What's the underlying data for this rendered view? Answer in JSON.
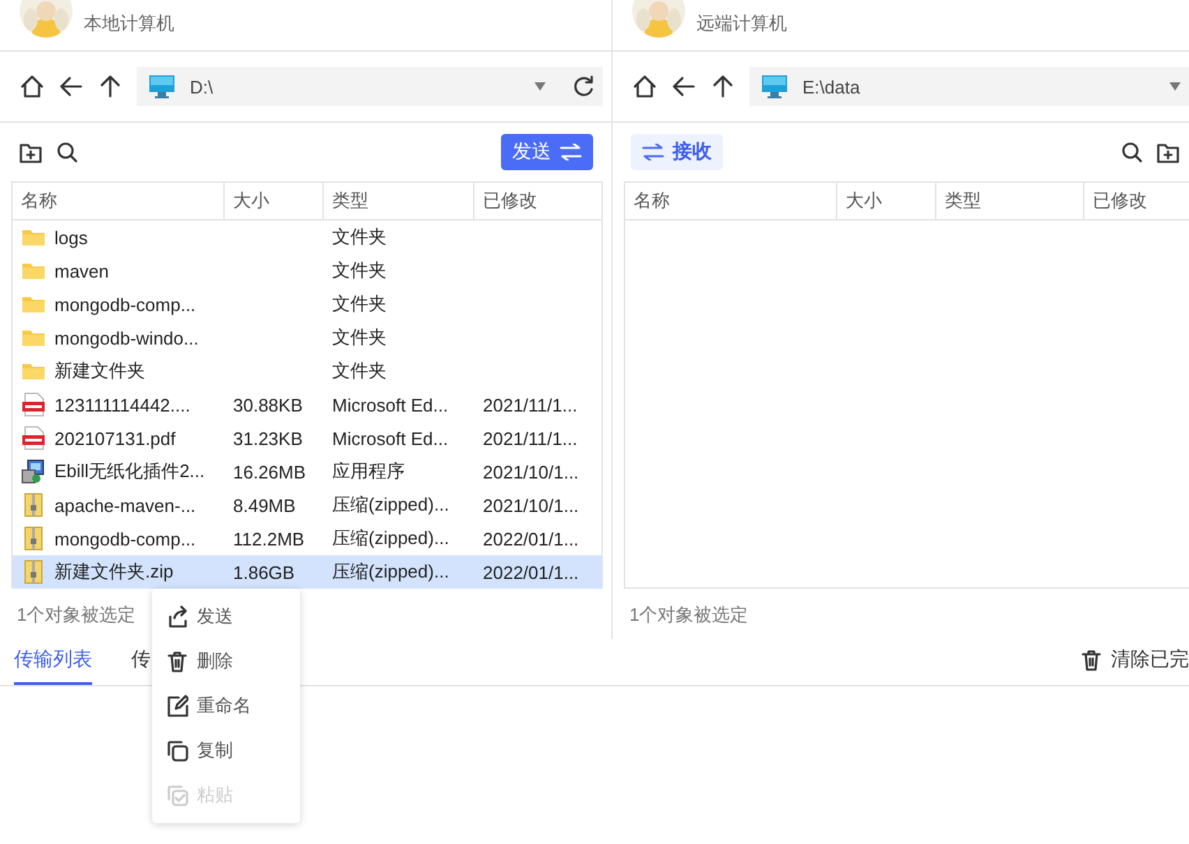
{
  "panels": [
    {
      "subtitle": "本地计算机",
      "path": "D:\\",
      "action": {
        "label": "发送",
        "kind": "send"
      },
      "columns": [
        "名称",
        "大小",
        "类型",
        "已修改"
      ],
      "rows": [
        {
          "kind": "folder",
          "name": "logs",
          "size": "",
          "type": "文件夹",
          "modified": "",
          "selected": false
        },
        {
          "kind": "folder",
          "name": "maven",
          "size": "",
          "type": "文件夹",
          "modified": "",
          "selected": false
        },
        {
          "kind": "folder",
          "name": "mongodb-comp...",
          "size": "",
          "type": "文件夹",
          "modified": "",
          "selected": false
        },
        {
          "kind": "folder",
          "name": "mongodb-windo...",
          "size": "",
          "type": "文件夹",
          "modified": "",
          "selected": false
        },
        {
          "kind": "folder",
          "name": "新建文件夹",
          "size": "",
          "type": "文件夹",
          "modified": "",
          "selected": false
        },
        {
          "kind": "pdf",
          "name": "123111114442....",
          "size": "30.88KB",
          "type": "Microsoft Ed...",
          "modified": "2021/11/1...",
          "selected": false
        },
        {
          "kind": "pdf",
          "name": "202107131.pdf",
          "size": "31.23KB",
          "type": "Microsoft Ed...",
          "modified": "2021/11/1...",
          "selected": false
        },
        {
          "kind": "app",
          "name": "Ebill无纸化插件2...",
          "size": "16.26MB",
          "type": "应用程序",
          "modified": "2021/10/1...",
          "selected": false
        },
        {
          "kind": "zip",
          "name": "apache-maven-...",
          "size": "8.49MB",
          "type": "压缩(zipped)...",
          "modified": "2021/10/1...",
          "selected": false
        },
        {
          "kind": "zip",
          "name": "mongodb-comp...",
          "size": "112.2MB",
          "type": "压缩(zipped)...",
          "modified": "2022/01/1...",
          "selected": false
        },
        {
          "kind": "zip",
          "name": "新建文件夹.zip",
          "size": "1.86GB",
          "type": "压缩(zipped)...",
          "modified": "2022/01/1...",
          "selected": true
        }
      ],
      "status": "1个对象被选定"
    },
    {
      "subtitle": "远端计算机",
      "path": "E:\\data",
      "action": {
        "label": "接收",
        "kind": "receive"
      },
      "columns": [
        "名称",
        "大小",
        "类型",
        "已修改"
      ],
      "status": "1个对象被选定"
    }
  ],
  "transfer_tabs": [
    {
      "label": "传输列表",
      "selected": true
    },
    {
      "label": "传",
      "selected": false
    }
  ],
  "clear_button": "清除已完",
  "context_menu": [
    {
      "kind": "send",
      "label": "发送",
      "disabled": false
    },
    {
      "kind": "delete",
      "label": "删除",
      "disabled": false
    },
    {
      "kind": "rename",
      "label": "重命名",
      "disabled": false
    },
    {
      "kind": "copy",
      "label": "复制",
      "disabled": false
    },
    {
      "kind": "paste",
      "label": "粘贴",
      "disabled": true
    }
  ]
}
